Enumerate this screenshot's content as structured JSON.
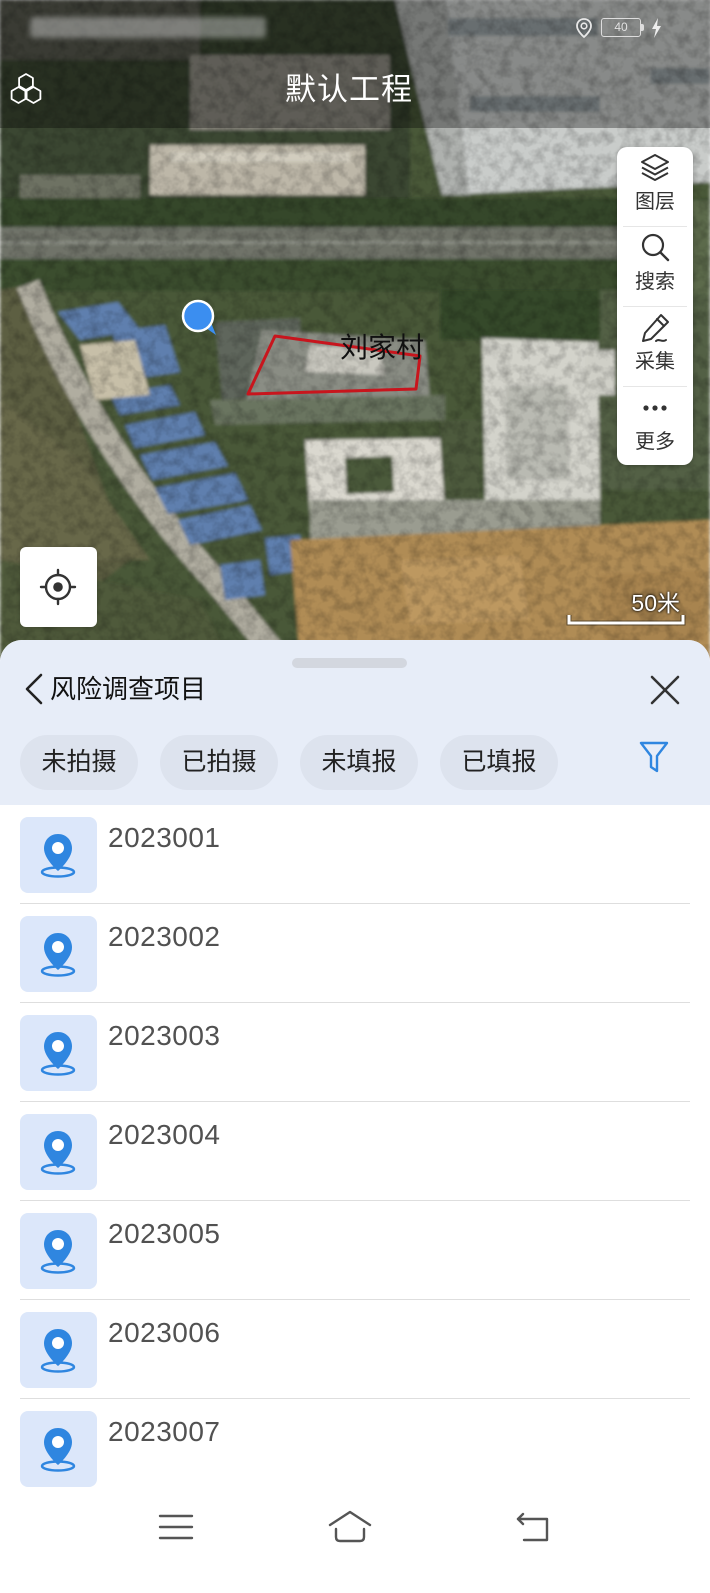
{
  "status_bar": {
    "battery_level": "40",
    "location_icon": "location-icon",
    "charging_icon": "bolt-icon"
  },
  "header": {
    "title": "默认工程",
    "icon": "cluster-icon"
  },
  "map": {
    "parcel_label": "刘家村",
    "scale_label": "50米"
  },
  "toolbar": {
    "items": [
      {
        "label": "图层",
        "icon": "layers-icon"
      },
      {
        "label": "搜索",
        "icon": "search-icon"
      },
      {
        "label": "采集",
        "icon": "pen-icon"
      },
      {
        "label": "更多",
        "icon": "more-icon"
      }
    ]
  },
  "locate_button": {
    "icon": "locate-icon"
  },
  "panel": {
    "title": "风险调查项目",
    "back_icon": "chevron-left-icon",
    "close_icon": "close-icon",
    "filter_icon": "filter-icon",
    "filters": [
      {
        "label": "未拍摄"
      },
      {
        "label": "已拍摄"
      },
      {
        "label": "未填报"
      },
      {
        "label": "已填报"
      }
    ],
    "items": [
      {
        "id": "2023001",
        "icon": "location-pin-icon"
      },
      {
        "id": "2023002",
        "icon": "location-pin-icon"
      },
      {
        "id": "2023003",
        "icon": "location-pin-icon"
      },
      {
        "id": "2023004",
        "icon": "location-pin-icon"
      },
      {
        "id": "2023005",
        "icon": "location-pin-icon"
      },
      {
        "id": "2023006",
        "icon": "location-pin-icon"
      },
      {
        "id": "2023007",
        "icon": "location-pin-icon"
      }
    ]
  },
  "nav_bar": {
    "items": [
      {
        "icon": "menu-icon"
      },
      {
        "icon": "home-icon"
      },
      {
        "icon": "back-icon"
      }
    ]
  },
  "colors": {
    "accent": "#2f86e0",
    "parcel_outline": "#c8151d",
    "panel_header_bg": "#e7edf8",
    "chip_bg": "#dde3ee",
    "icon_tile_bg": "#dce7fa",
    "marker": "#3b8ef0"
  }
}
